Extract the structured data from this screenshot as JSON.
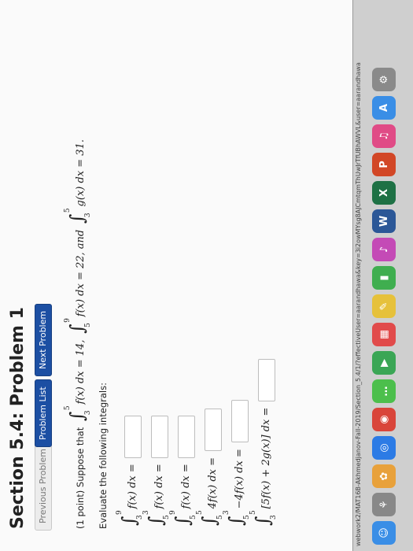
{
  "header": {
    "title": "Section 5.4: Problem 1"
  },
  "nav": {
    "previous": "Previous Problem",
    "list": "Problem List",
    "next": "Next Problem"
  },
  "problem": {
    "points": "(1 point) Suppose that",
    "given1": "f(x) dx = 14,",
    "given2": "f(x) dx = 22, and",
    "given3": "g(x) dx = 31.",
    "instruction": "Evaluate the following integrals:",
    "integrals": [
      {
        "expr": "f(x) dx =",
        "upper": "9",
        "lower": "3"
      },
      {
        "expr": "f(x) dx =",
        "upper": "3",
        "lower": "5"
      },
      {
        "expr": "f(x) dx =",
        "upper": "9",
        "lower": "5"
      },
      {
        "expr": "4f(x) dx =",
        "upper": "5",
        "lower": "5"
      },
      {
        "expr": "−4f(x) dx =",
        "upper": "3",
        "lower": "5"
      },
      {
        "expr": "[5f(x) + 2g(x)] dx =",
        "upper": "5",
        "lower": "3"
      }
    ],
    "bounds": {
      "g1_upper": "5",
      "g1_lower": "3",
      "g2_upper": "9",
      "g2_lower": "5",
      "g3_upper": "5",
      "g3_lower": "3"
    }
  },
  "browser": {
    "url": "webwork2/MAT16B-Akhmedjanov-Fall-2019/Section_5.4/1/?effectiveUser=aarandhawa&key=3i2owMYsg8AJCmtqmThUwJrTfUBhAWVL&user=aarandhawa"
  },
  "dock": [
    {
      "icon": "finder-icon",
      "label": "☺",
      "color": "#3a8ee6"
    },
    {
      "icon": "launchpad-icon",
      "label": "⚘",
      "color": "#888888"
    },
    {
      "icon": "photos-icon",
      "label": "✿",
      "color": "#e8a13b"
    },
    {
      "icon": "safari-icon",
      "label": "◎",
      "color": "#2c7be5"
    },
    {
      "icon": "chrome-icon",
      "label": "◉",
      "color": "#d9453a"
    },
    {
      "icon": "messages-icon",
      "label": "…",
      "color": "#4cbf4c"
    },
    {
      "icon": "facetime-icon",
      "label": "▶",
      "color": "#3aa655"
    },
    {
      "icon": "calendar-icon",
      "label": "▦",
      "color": "#e14b4b"
    },
    {
      "icon": "notes-icon",
      "label": "✎",
      "color": "#e6c13b"
    },
    {
      "icon": "numbers-icon",
      "label": "▮",
      "color": "#3fae4f"
    },
    {
      "icon": "itunes-icon",
      "label": "♪",
      "color": "#c44ab6"
    },
    {
      "icon": "word-icon",
      "label": "W",
      "color": "#2b5797"
    },
    {
      "icon": "excel-icon",
      "label": "X",
      "color": "#1e7145"
    },
    {
      "icon": "powerpoint-icon",
      "label": "P",
      "color": "#d24726"
    },
    {
      "icon": "music-icon",
      "label": "♫",
      "color": "#e04b86"
    },
    {
      "icon": "appstore-icon",
      "label": "A",
      "color": "#3a8ee6"
    },
    {
      "icon": "settings-icon",
      "label": "⚙",
      "color": "#8a8a8a"
    }
  ]
}
